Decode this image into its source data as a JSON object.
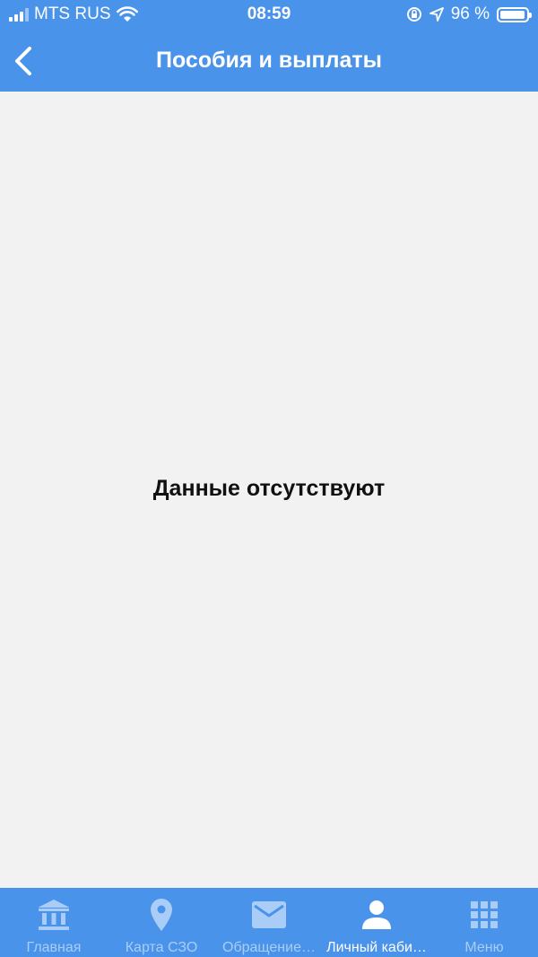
{
  "status_bar": {
    "carrier": "MTS RUS",
    "time": "08:59",
    "battery_text": "96 %",
    "battery_level": 0.96
  },
  "header": {
    "title": "Пособия и выплаты"
  },
  "main": {
    "empty_message": "Данные отсутствуют"
  },
  "tabbar": {
    "active_index": 3,
    "tabs": [
      {
        "label": "Главная",
        "icon": "bank-icon"
      },
      {
        "label": "Карта СЗО",
        "icon": "map-pin-icon"
      },
      {
        "label": "Обращение…",
        "icon": "mail-icon"
      },
      {
        "label": "Личный каби…",
        "icon": "user-icon"
      },
      {
        "label": "Меню",
        "icon": "grid-icon"
      }
    ]
  },
  "colors": {
    "primary": "#4a93ea",
    "background": "#f2f2f2",
    "tab_inactive": "#a9cdf6"
  }
}
